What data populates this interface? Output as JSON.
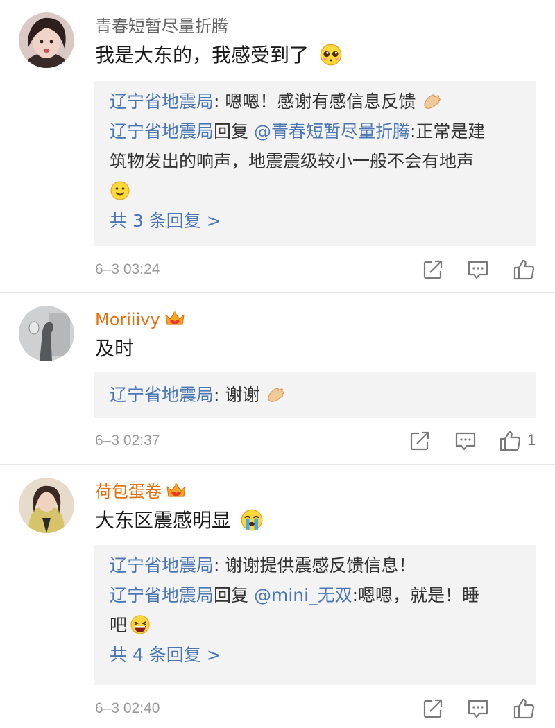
{
  "comments": [
    {
      "username": "青春短暂尽量折腾",
      "text": "我是大东的，我感受到了",
      "text_emoji": "pleading-face-emoji",
      "replies": [
        {
          "author": "辽宁省地震局",
          "body": ": 嗯嗯！感谢有感信息反馈",
          "emoji": "clap-hand-emoji"
        },
        {
          "author": "辽宁省地震局",
          "reply_word": "回复",
          "mention": "@青春短暂尽量折腾",
          "body_line1": ":正常是建",
          "body_line2": "筑物发出的响声，地震震级较小一般不会有地声",
          "emoji": "smile-face-emoji"
        }
      ],
      "more_replies": "共 3 条回复 >",
      "timestamp": "6–3 03:24",
      "like_count": ""
    },
    {
      "username": "Moriiivy",
      "text": "及时",
      "vip_icon": "vip-crown-icon",
      "replies": [
        {
          "author": "辽宁省地震局",
          "body": ": 谢谢",
          "emoji": "clap-hand-emoji"
        }
      ],
      "timestamp": "6–3 02:37",
      "like_count": "1"
    },
    {
      "username": "荷包蛋卷",
      "text": "大东区震感明显",
      "text_emoji": "crying-face-emoji",
      "vip_icon": "vip-crown-icon",
      "replies": [
        {
          "author": "辽宁省地震局",
          "body": ": 谢谢提供震感反馈信息！"
        },
        {
          "author": "辽宁省地震局",
          "reply_word": "回复",
          "mention": "@mini_无双",
          "body_line1": ":嗯嗯，就是！睡",
          "body_line2": "吧",
          "emoji": "laughing-face-emoji"
        }
      ],
      "more_replies": "共 4 条回复 >",
      "timestamp": "6–3 02:40",
      "like_count": ""
    }
  ],
  "colors": {
    "link_blue": "#4a77b4",
    "vip_orange": "#e8700c",
    "reply_bg": "#f3f3f3"
  }
}
